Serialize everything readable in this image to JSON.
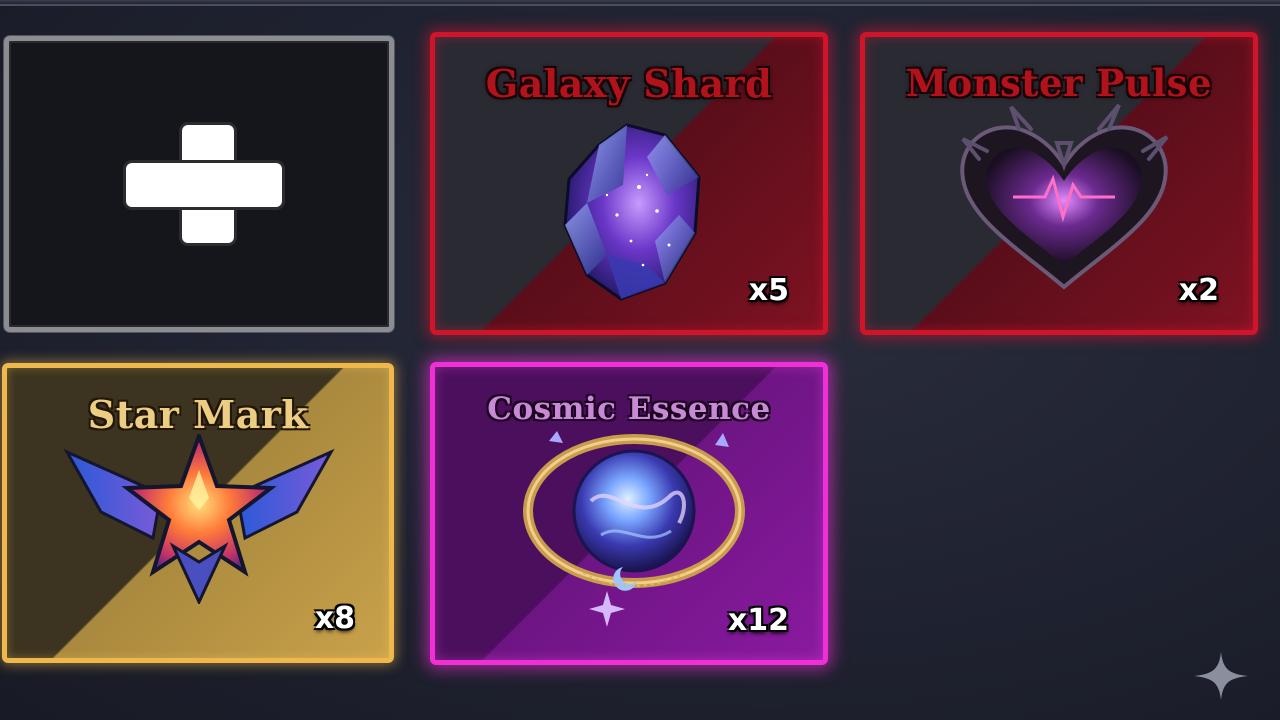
{
  "inventory": {
    "empty_slot": {
      "icon": "plus-icon"
    },
    "items": [
      {
        "name": "Galaxy Shard",
        "count": "x5",
        "rarity_color": "#d0142a",
        "icon": "galaxy-shard-crystal-icon"
      },
      {
        "name": "Monster Pulse",
        "count": "x2",
        "rarity_color": "#d0142a",
        "icon": "monster-heart-pulse-icon"
      },
      {
        "name": "Star Mark",
        "count": "x8",
        "rarity_color": "#f0b84a",
        "icon": "winged-star-emblem-icon"
      },
      {
        "name": "Cosmic Essence",
        "count": "x12",
        "rarity_color": "#f12fd6",
        "icon": "cosmic-orb-amulet-icon"
      }
    ]
  },
  "corner_mark": {
    "icon": "sparkle-icon"
  }
}
